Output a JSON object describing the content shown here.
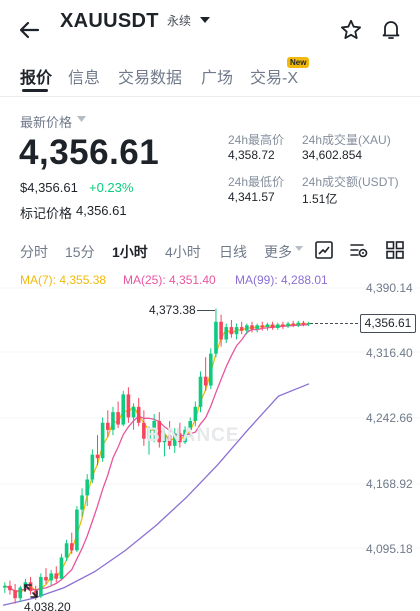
{
  "header": {
    "symbol": "XAUUSDT",
    "contract_type": "永续",
    "icons": {
      "back": "back-arrow-icon",
      "dropdown": "caret-down-icon",
      "favorite": "star-icon",
      "notification": "bell-icon"
    }
  },
  "tabs": [
    {
      "label": "报价",
      "active": true
    },
    {
      "label": "信息"
    },
    {
      "label": "交易数据"
    },
    {
      "label": "广场"
    },
    {
      "label": "交易-X"
    }
  ],
  "new_badge": "New",
  "price": {
    "label": "最新价格",
    "last": "4,356.61",
    "usd": "$4,356.61",
    "change": "+0.23%",
    "mark_label": "标记价格",
    "mark_value": "4,356.61",
    "change_color": "#0ecb81"
  },
  "stats": {
    "high_label": "24h最高价",
    "high_value": "4,358.72",
    "low_label": "24h最低价",
    "low_value": "4,341.57",
    "vol_base_label": "24h成交量(XAU)",
    "vol_base_value": "34,602.854",
    "vol_quote_label": "24h成交额(USDT)",
    "vol_quote_value": "1.51亿"
  },
  "intervals": [
    "分时",
    "15分",
    "1小时",
    "4小时",
    "日线",
    "更多"
  ],
  "active_interval": "1小时",
  "toolbar_icons": [
    "chart-settings-icon",
    "indicator-icon",
    "grid-layout-icon"
  ],
  "indicators": {
    "ma7": {
      "label": "MA(7): 4,355.38",
      "color": "#f0b90b"
    },
    "ma25": {
      "label": "MA(25): 4,351.40",
      "color": "#e8559f"
    },
    "ma99": {
      "label": "MA(99): 4,288.01",
      "color": "#8b6fd3"
    }
  },
  "chart_data": {
    "type": "candlestick",
    "y_axis_ticks": [
      "4,390.14",
      "4,316.40",
      "4,242.66",
      "4,168.92",
      "4,095.18"
    ],
    "current_price_tag": "4,356.61",
    "high_annotation": "4,373.38",
    "low_annotation": "4,038.20",
    "up_color": "#0ecb81",
    "down_color": "#f6465d",
    "watermark": "BINANCE",
    "candles": [
      [
        4058,
        4064,
        4052,
        4060
      ],
      [
        4060,
        4066,
        4050,
        4055
      ],
      [
        4055,
        4062,
        4040,
        4046
      ],
      [
        4046,
        4060,
        4042,
        4058
      ],
      [
        4058,
        4068,
        4054,
        4064
      ],
      [
        4064,
        4070,
        4050,
        4054
      ],
      [
        4054,
        4060,
        4044,
        4048
      ],
      [
        4048,
        4074,
        4046,
        4070
      ],
      [
        4070,
        4080,
        4062,
        4066
      ],
      [
        4066,
        4078,
        4060,
        4074
      ],
      [
        4074,
        4082,
        4064,
        4068
      ],
      [
        4068,
        4096,
        4066,
        4092
      ],
      [
        4092,
        4112,
        4088,
        4108
      ],
      [
        4108,
        4120,
        4096,
        4100
      ],
      [
        4100,
        4150,
        4098,
        4146
      ],
      [
        4146,
        4170,
        4138,
        4162
      ],
      [
        4162,
        4186,
        4150,
        4180
      ],
      [
        4180,
        4214,
        4176,
        4208
      ],
      [
        4208,
        4230,
        4196,
        4204
      ],
      [
        4204,
        4250,
        4200,
        4244
      ],
      [
        4244,
        4258,
        4228,
        4236
      ],
      [
        4236,
        4262,
        4230,
        4256
      ],
      [
        4256,
        4268,
        4238,
        4242
      ],
      [
        4242,
        4280,
        4240,
        4276
      ],
      [
        4276,
        4284,
        4244,
        4250
      ],
      [
        4250,
        4266,
        4236,
        4262
      ],
      [
        4262,
        4272,
        4240,
        4244
      ],
      [
        4244,
        4258,
        4218,
        4226
      ],
      [
        4226,
        4240,
        4208,
        4236
      ],
      [
        4236,
        4254,
        4222,
        4246
      ],
      [
        4246,
        4256,
        4216,
        4222
      ],
      [
        4222,
        4236,
        4206,
        4230
      ],
      [
        4230,
        4246,
        4214,
        4218
      ],
      [
        4218,
        4238,
        4210,
        4232
      ],
      [
        4232,
        4244,
        4216,
        4222
      ],
      [
        4222,
        4240,
        4220,
        4236
      ],
      [
        4236,
        4250,
        4228,
        4246
      ],
      [
        4246,
        4268,
        4240,
        4262
      ],
      [
        4262,
        4302,
        4256,
        4296
      ],
      [
        4296,
        4318,
        4280,
        4286
      ],
      [
        4286,
        4328,
        4282,
        4322
      ],
      [
        4322,
        4373,
        4318,
        4358
      ],
      [
        4358,
        4366,
        4330,
        4338
      ],
      [
        4338,
        4356,
        4334,
        4352
      ],
      [
        4352,
        4360,
        4340,
        4344
      ],
      [
        4344,
        4356,
        4338,
        4352
      ],
      [
        4352,
        4358,
        4344,
        4348
      ],
      [
        4348,
        4356,
        4344,
        4354
      ],
      [
        4354,
        4358,
        4346,
        4350
      ],
      [
        4350,
        4356,
        4346,
        4354
      ],
      [
        4354,
        4358,
        4348,
        4352
      ],
      [
        4352,
        4357,
        4348,
        4355
      ],
      [
        4355,
        4358,
        4349,
        4351
      ],
      [
        4351,
        4357,
        4349,
        4355
      ],
      [
        4355,
        4358,
        4350,
        4353
      ],
      [
        4353,
        4358,
        4351,
        4356
      ],
      [
        4356,
        4359,
        4352,
        4354
      ],
      [
        4354,
        4359,
        4352,
        4357
      ],
      [
        4357,
        4359,
        4353,
        4355
      ],
      [
        4355,
        4358,
        4353,
        4356.61
      ]
    ],
    "ma99_line": [
      4038,
      4046,
      4058,
      4076,
      4100,
      4128,
      4160,
      4196,
      4236,
      4274,
      4288
    ]
  }
}
